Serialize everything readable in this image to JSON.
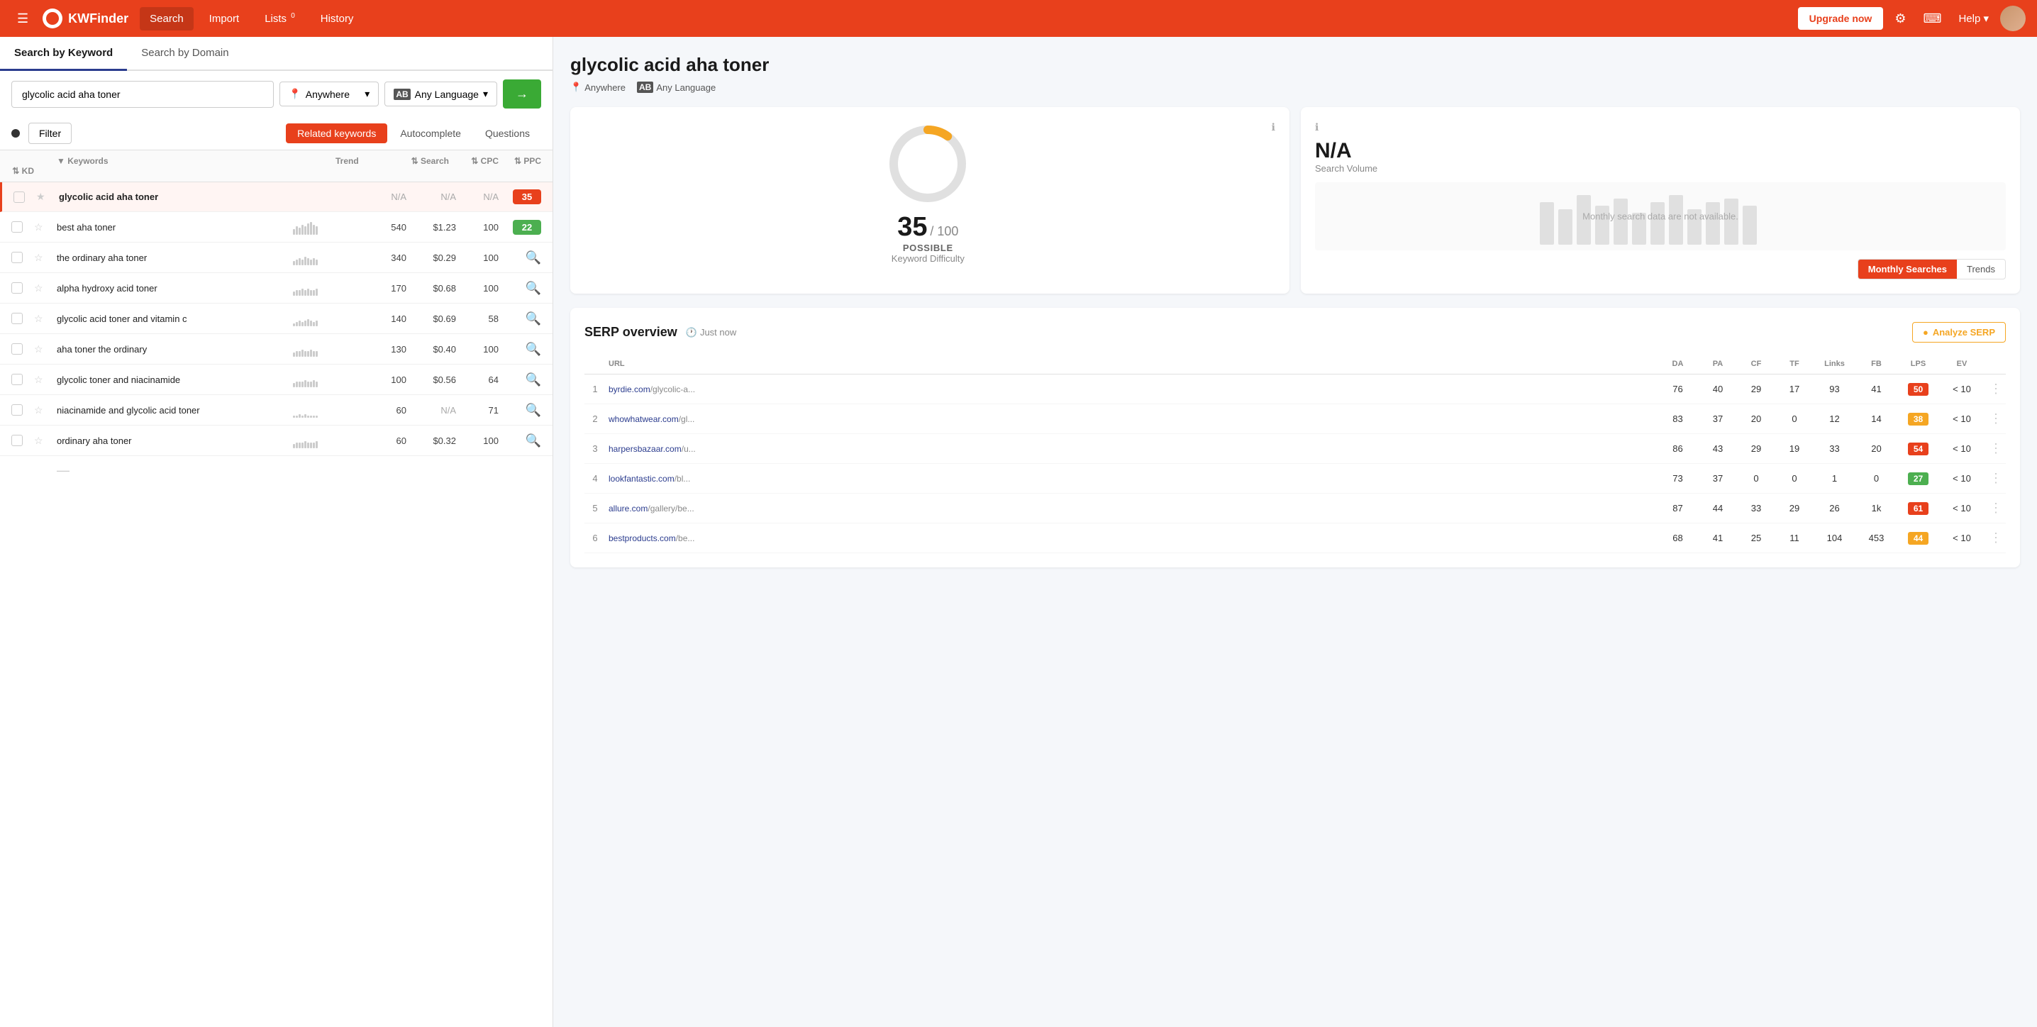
{
  "topnav": {
    "logo_text": "KWFinder",
    "nav_items": [
      "Search",
      "Import",
      "Lists",
      "History"
    ],
    "lists_badge": "0",
    "upgrade_label": "Upgrade now",
    "help_label": "Help"
  },
  "left_panel": {
    "tab_keyword": "Search by Keyword",
    "tab_domain": "Search by Domain",
    "keyword_input": "glycolic acid aha toner",
    "location_value": "Anywhere",
    "language_value": "Any Language",
    "search_arrow": "→",
    "filter_label": "Filter",
    "kw_tabs": [
      "Related keywords",
      "Autocomplete",
      "Questions"
    ],
    "table_headers": [
      "Keywords",
      "Trend",
      "Search",
      "CPC",
      "PPC",
      "KD"
    ],
    "keywords": [
      {
        "name": "glycolic acid aha toner",
        "trend": [],
        "search": "N/A",
        "cpc": "N/A",
        "ppc": "N/A",
        "kd": 35,
        "kd_color": "orange",
        "selected": true
      },
      {
        "name": "best aha toner",
        "trend": [
          3,
          5,
          4,
          6,
          5,
          7,
          8,
          6,
          5,
          4,
          6,
          7
        ],
        "search": "540",
        "cpc": "$1.23",
        "ppc": "100",
        "kd": 22,
        "kd_color": "green"
      },
      {
        "name": "the ordinary aha toner",
        "trend": [
          2,
          3,
          4,
          3,
          5,
          4,
          3,
          4,
          3,
          4,
          5,
          4
        ],
        "search": "340",
        "cpc": "$0.29",
        "ppc": "100",
        "kd": null,
        "kd_color": "search"
      },
      {
        "name": "alpha hydroxy acid toner",
        "trend": [
          2,
          3,
          3,
          4,
          3,
          4,
          3,
          3,
          4,
          3,
          3,
          4
        ],
        "search": "170",
        "cpc": "$0.68",
        "ppc": "100",
        "kd": null,
        "kd_color": "search"
      },
      {
        "name": "glycolic acid toner and vitamin c",
        "trend": [
          1,
          2,
          3,
          2,
          3,
          4,
          3,
          2,
          3,
          2,
          3,
          3
        ],
        "search": "140",
        "cpc": "$0.69",
        "ppc": "58",
        "kd": null,
        "kd_color": "search"
      },
      {
        "name": "aha toner the ordinary",
        "trend": [
          2,
          3,
          3,
          4,
          3,
          3,
          4,
          3,
          3,
          3,
          4,
          3
        ],
        "search": "130",
        "cpc": "$0.40",
        "ppc": "100",
        "kd": null,
        "kd_color": "search"
      },
      {
        "name": "glycolic toner and niacinamide",
        "trend": [
          2,
          3,
          3,
          3,
          4,
          3,
          3,
          4,
          3,
          3,
          3,
          4
        ],
        "search": "100",
        "cpc": "$0.56",
        "ppc": "64",
        "kd": null,
        "kd_color": "search"
      },
      {
        "name": "niacinamide and glycolic acid toner",
        "trend": [
          1,
          1,
          2,
          1,
          2,
          1,
          1,
          1,
          1,
          1,
          1,
          1
        ],
        "search": "60",
        "cpc": "N/A",
        "ppc": "71",
        "kd": null,
        "kd_color": "search"
      },
      {
        "name": "ordinary aha toner",
        "trend": [
          2,
          3,
          3,
          3,
          4,
          3,
          3,
          3,
          4,
          3,
          3,
          4
        ],
        "search": "60",
        "cpc": "$0.32",
        "ppc": "100",
        "kd": null,
        "kd_color": "search"
      }
    ]
  },
  "right_panel": {
    "keyword_title": "glycolic acid aha toner",
    "location": "Anywhere",
    "language": "Any Language",
    "kd_value": "35",
    "kd_max": "100",
    "kd_label": "POSSIBLE",
    "kd_sublabel": "Keyword Difficulty",
    "sv_value": "N/A",
    "sv_sublabel": "Search Volume",
    "sv_no_data": "Monthly search data are not available.",
    "sv_tab_monthly": "Monthly Searches",
    "sv_tab_trends": "Trends",
    "serp_title": "SERP overview",
    "serp_time": "Just now",
    "analyze_btn": "Analyze SERP",
    "serp_headers": [
      "",
      "URL",
      "DA",
      "PA",
      "CF",
      "TF",
      "Links",
      "FB",
      "LPS",
      "EV",
      ""
    ],
    "serp_rows": [
      {
        "num": 1,
        "url_base": "byrdie.com",
        "url_path": "/glycolic-a...",
        "da": 76,
        "pa": 40,
        "cf": 29,
        "tf": 17,
        "links": 93,
        "fb": 41,
        "lps": 50,
        "lps_color": "orange",
        "ev": "< 10"
      },
      {
        "num": 2,
        "url_base": "whowhatwear.com",
        "url_path": "/gl...",
        "da": 83,
        "pa": 37,
        "cf": 20,
        "tf": 0,
        "links": 12,
        "fb": 14,
        "lps": 38,
        "lps_color": "yellow",
        "ev": "< 10"
      },
      {
        "num": 3,
        "url_base": "harpersbazaar.com",
        "url_path": "/u...",
        "da": 86,
        "pa": 43,
        "cf": 29,
        "tf": 19,
        "links": 33,
        "fb": 20,
        "lps": 54,
        "lps_color": "orange",
        "ev": "< 10"
      },
      {
        "num": 4,
        "url_base": "lookfantastic.com",
        "url_path": "/bl...",
        "da": 73,
        "pa": 37,
        "cf": 0,
        "tf": 0,
        "links": 1,
        "fb": 0,
        "lps": 27,
        "lps_color": "green",
        "ev": "< 10"
      },
      {
        "num": 5,
        "url_base": "allure.com",
        "url_path": "/gallery/be...",
        "da": 87,
        "pa": 44,
        "cf": 33,
        "tf": 29,
        "links": 26,
        "fb": "1k",
        "lps": 61,
        "lps_color": "orange",
        "ev": "< 10"
      },
      {
        "num": 6,
        "url_base": "bestproducts.com",
        "url_path": "/be...",
        "da": 68,
        "pa": 41,
        "cf": 25,
        "tf": 11,
        "links": 104,
        "fb": 453,
        "lps": 44,
        "lps_color": "yellow",
        "ev": "< 10"
      }
    ]
  }
}
